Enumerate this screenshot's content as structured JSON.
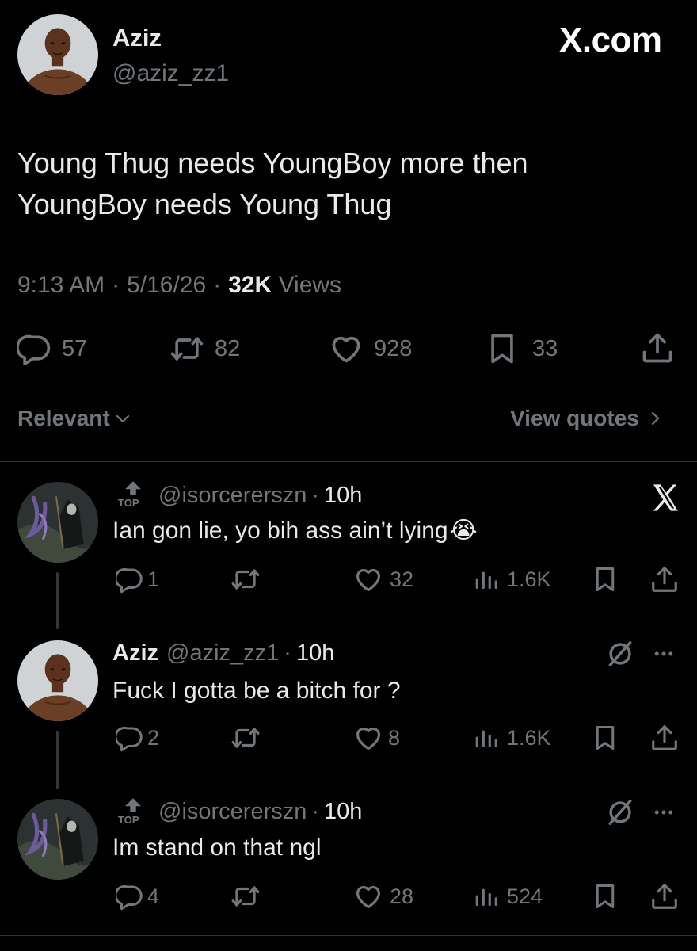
{
  "brand": {
    "watermark": "X.com"
  },
  "tweet": {
    "author": {
      "name": "Aziz",
      "handle": "@aziz_zz1"
    },
    "text_line1": "Young Thug needs YoungBoy more then",
    "text_line2": "YoungBoy needs Young Thug",
    "time": "9:13 AM",
    "date": "5/16/26",
    "views_count": "32K",
    "views_label": "Views",
    "sep": "·",
    "stats": {
      "replies": "57",
      "reposts": "82",
      "likes": "928",
      "bookmarks": "33"
    }
  },
  "sort": {
    "label": "Relevant",
    "view_quotes": "View quotes"
  },
  "replies": [
    {
      "badge": "TOP",
      "handle": "@isorcererszn",
      "time": "10h",
      "text": "Ian gon lie, yo bih ass ain’t lying",
      "emoji": "😭",
      "stats": {
        "replies": "1",
        "likes": "32",
        "views": "1.6K"
      }
    },
    {
      "name": "Aziz",
      "handle": "@aziz_zz1",
      "time": "10h",
      "text": "Fuck I gotta be a bitch for ?",
      "stats": {
        "replies": "2",
        "likes": "8",
        "views": "1.6K"
      }
    },
    {
      "badge": "TOP",
      "handle": "@isorcererszn",
      "time": "10h",
      "text": "Im stand on that ngl",
      "stats": {
        "replies": "4",
        "likes": "28",
        "views": "524"
      }
    }
  ],
  "icons": {
    "reply": "speech-bubble-icon",
    "repost": "repost-arrows-icon",
    "like": "heart-icon",
    "bookmark": "bookmark-icon",
    "share": "share-upload-icon",
    "views": "bar-chart-icon",
    "close": "x-close-icon",
    "no-ai": "slashed-circle-icon",
    "more": "ellipsis-icon",
    "chevron": "chevron-icon"
  },
  "colors": {
    "background": "#000000",
    "text": "#e7e9ea",
    "muted": "#71767b",
    "divider": "#2f3336"
  }
}
